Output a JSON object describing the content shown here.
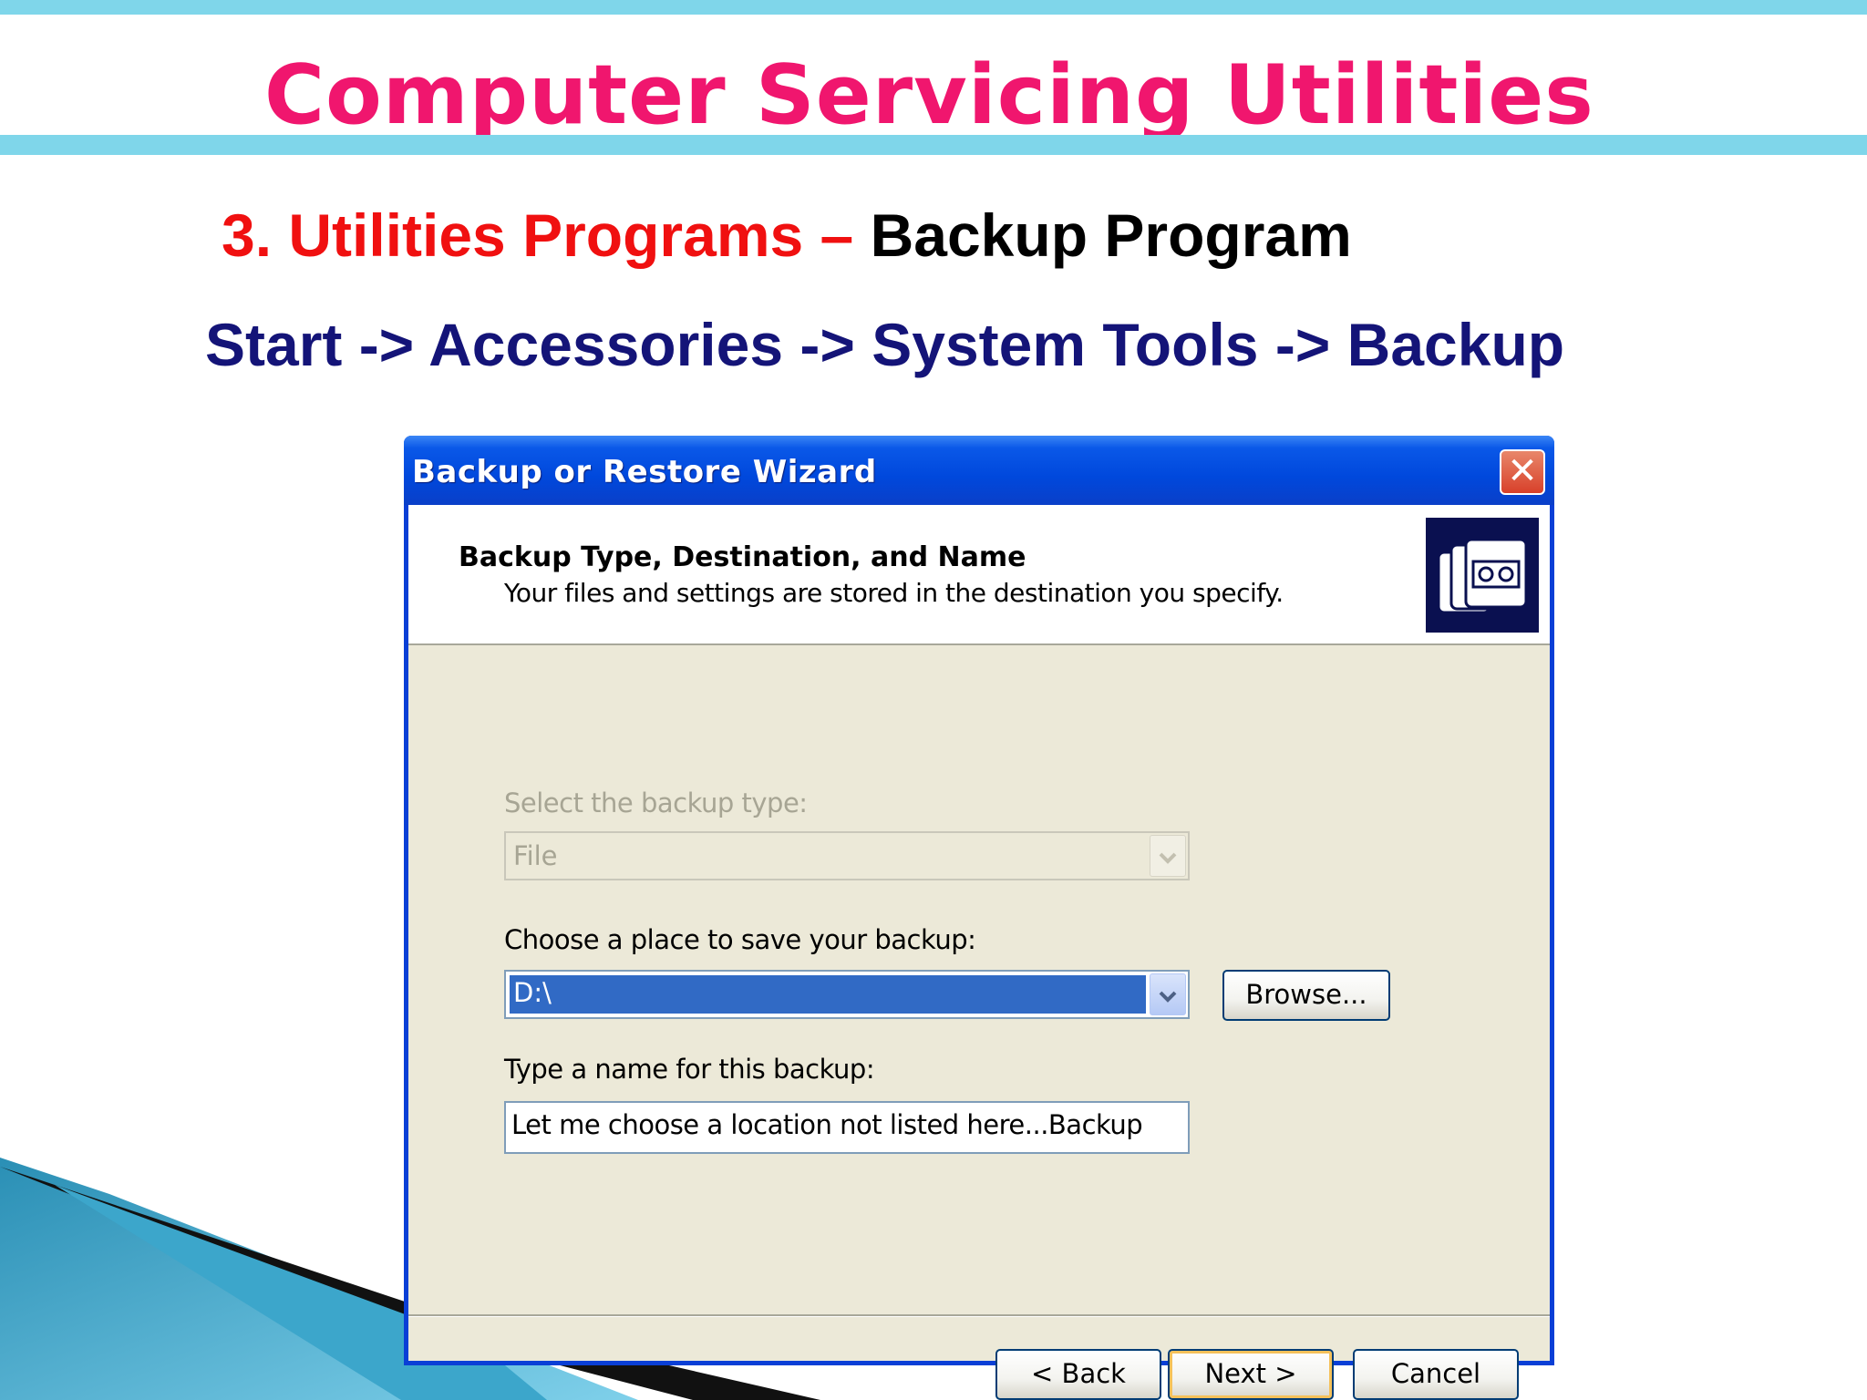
{
  "slide": {
    "title": "Computer Servicing Utilities",
    "subtitle_part1": "3. Utilities Programs –",
    "subtitle_part2": "Backup  Program",
    "path": "Start -> Accessories  -> System Tools  -> Backup"
  },
  "colors": {
    "title": "#f0166e",
    "subtitle_red": "#f01010",
    "path_navy": "#141478",
    "accent_bar": "#7fd6ea",
    "xp_blue": "#0a3fd6",
    "selection": "#316ac5"
  },
  "dialog": {
    "title": "Backup or Restore Wizard",
    "close_icon": "close-x-icon",
    "header_title": "Backup Type, Destination, and Name",
    "header_subtitle": "Your files and settings are stored in the destination you specify.",
    "header_icon": "backup-tapes-icon",
    "backup_type": {
      "label": "Select the backup type:",
      "value": "File",
      "disabled": true
    },
    "destination": {
      "label": "Choose a place to save your backup:",
      "value": "D:\\",
      "browse_label": "Browse..."
    },
    "backup_name": {
      "label": "Type a name for this backup:",
      "value": "Let me choose a location not listed here...Backup"
    },
    "buttons": {
      "back": "< Back",
      "next": "Next >",
      "cancel": "Cancel"
    }
  }
}
